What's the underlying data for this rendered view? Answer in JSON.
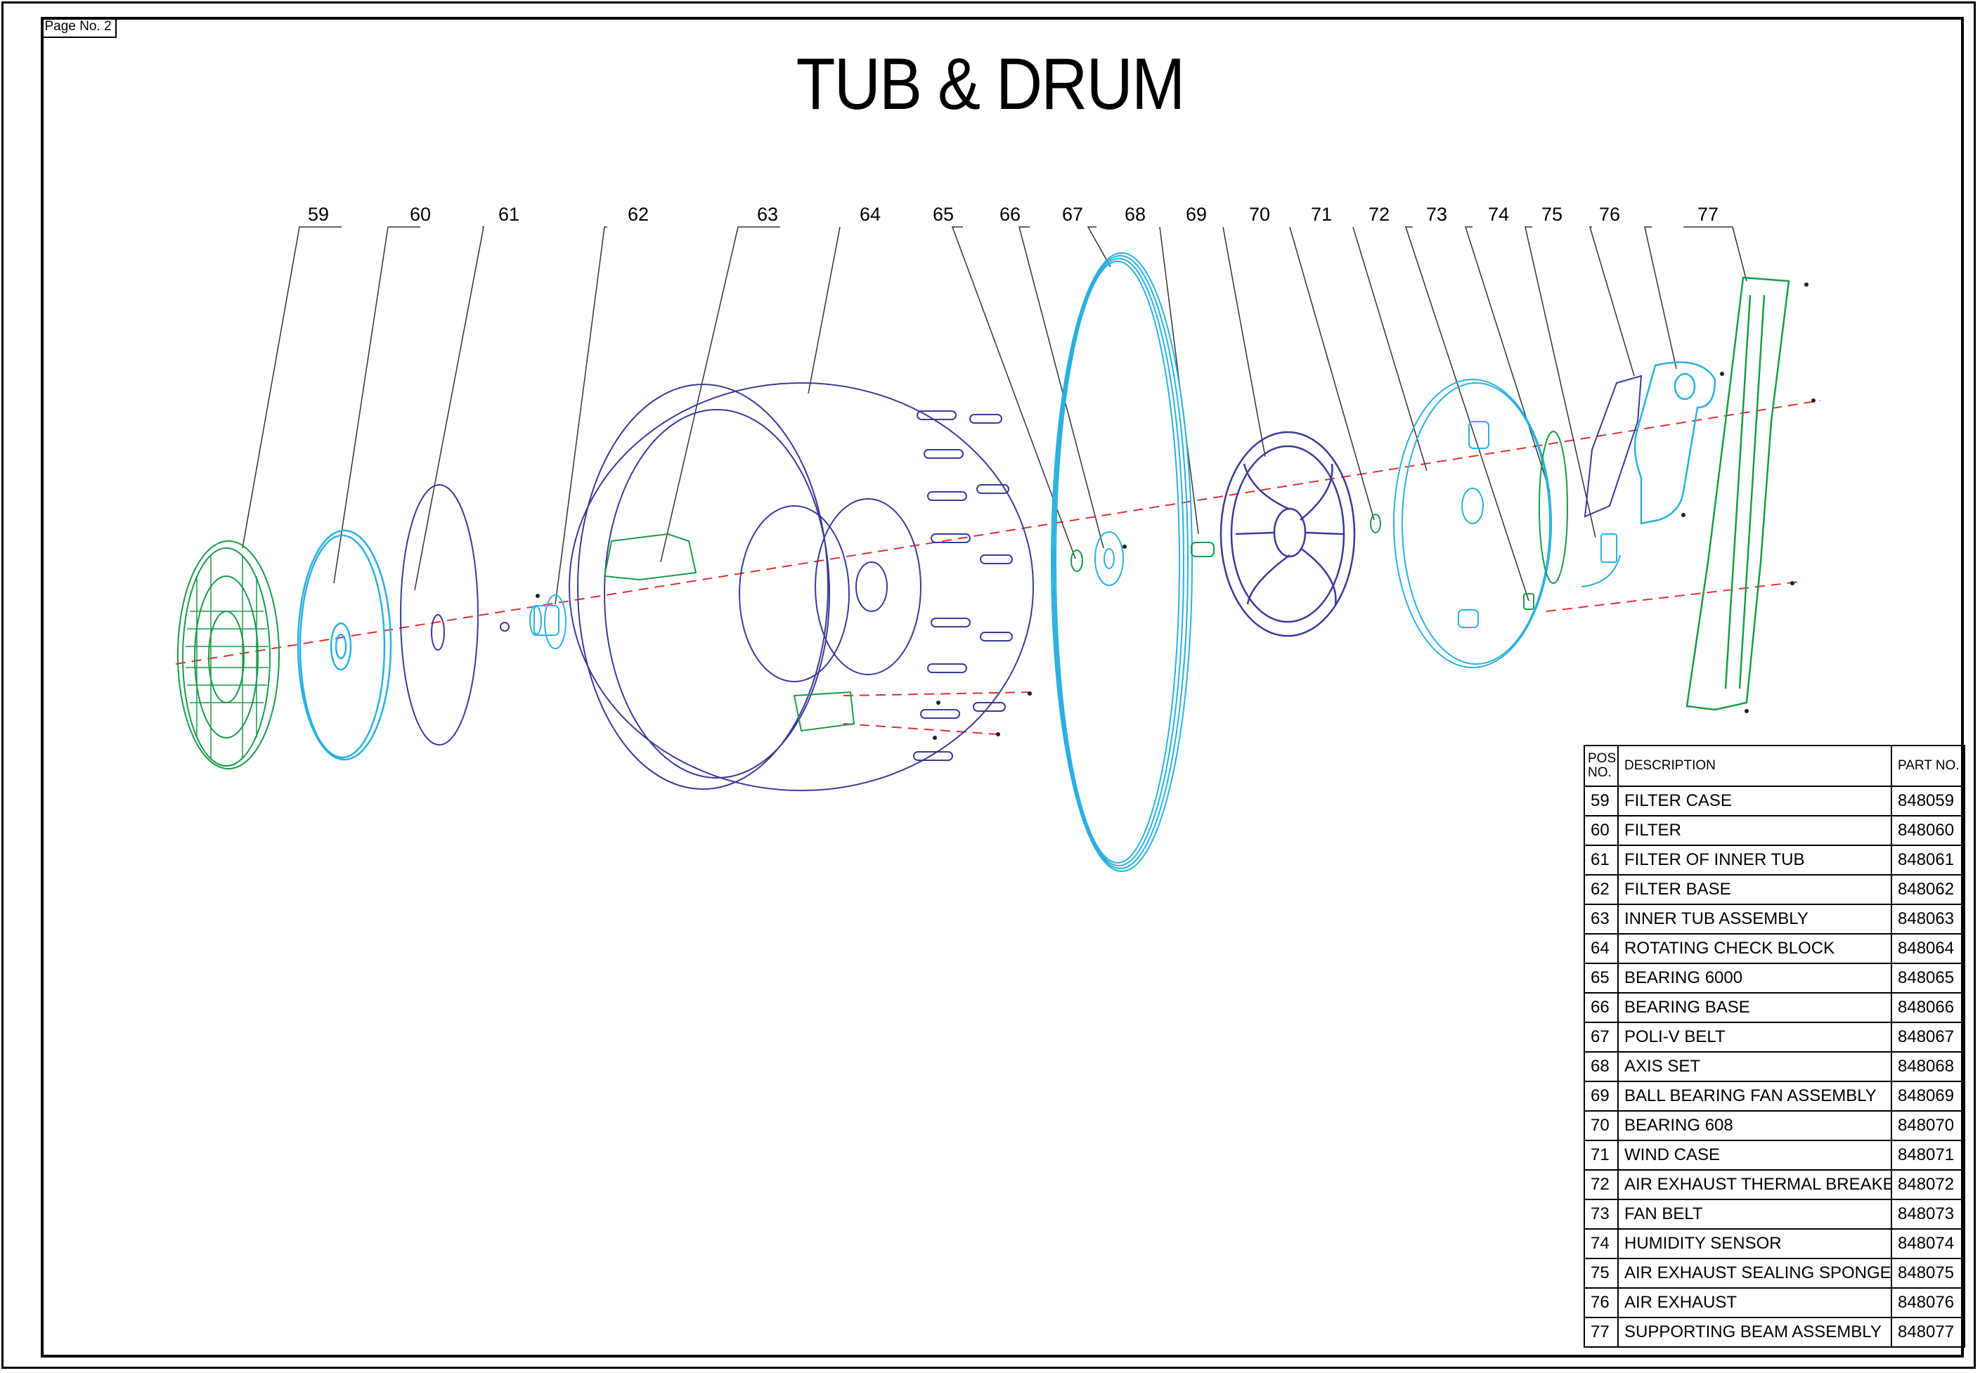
{
  "page_label": "Page No. 2",
  "title": "TUB & DRUM",
  "callouts": [
    "59",
    "60",
    "61",
    "62",
    "63",
    "64",
    "65",
    "66",
    "67",
    "68",
    "69",
    "70",
    "71",
    "72",
    "73",
    "74",
    "75",
    "76",
    "77"
  ],
  "table": {
    "headers": {
      "pos": "POS. NO.",
      "description": "DESCRIPTION",
      "part_no": "PART NO."
    },
    "rows": [
      {
        "pos": "59",
        "description": "FILTER CASE",
        "part_no": "848059"
      },
      {
        "pos": "60",
        "description": "FILTER",
        "part_no": "848060"
      },
      {
        "pos": "61",
        "description": "FILTER OF INNER TUB",
        "part_no": "848061"
      },
      {
        "pos": "62",
        "description": "FILTER BASE",
        "part_no": "848062"
      },
      {
        "pos": "63",
        "description": "INNER TUB ASSEMBLY",
        "part_no": "848063"
      },
      {
        "pos": "64",
        "description": "ROTATING CHECK BLOCK",
        "part_no": "848064"
      },
      {
        "pos": "65",
        "description": "BEARING 6000",
        "part_no": "848065"
      },
      {
        "pos": "66",
        "description": "BEARING BASE",
        "part_no": "848066"
      },
      {
        "pos": "67",
        "description": "POLI-V BELT",
        "part_no": "848067"
      },
      {
        "pos": "68",
        "description": "AXIS SET",
        "part_no": "848068"
      },
      {
        "pos": "69",
        "description": "BALL BEARING FAN ASSEMBLY",
        "part_no": "848069"
      },
      {
        "pos": "70",
        "description": "BEARING 608",
        "part_no": "848070"
      },
      {
        "pos": "71",
        "description": "WIND CASE",
        "part_no": "848071"
      },
      {
        "pos": "72",
        "description": "AIR EXHAUST THERMAL BREAKER",
        "part_no": "848072"
      },
      {
        "pos": "73",
        "description": "FAN BELT",
        "part_no": "848073"
      },
      {
        "pos": "74",
        "description": "HUMIDITY SENSOR",
        "part_no": "848074"
      },
      {
        "pos": "75",
        "description": "AIR EXHAUST SEALING SPONGE",
        "part_no": "848075"
      },
      {
        "pos": "76",
        "description": "AIR EXHAUST",
        "part_no": "848076"
      },
      {
        "pos": "77",
        "description": "SUPPORTING BEAM ASSEMBLY",
        "part_no": "848077"
      }
    ]
  },
  "colors": {
    "green": "#1a9a4a",
    "cyan": "#2ab0e0",
    "navy": "#3a3a98",
    "axis": "#e03030"
  }
}
